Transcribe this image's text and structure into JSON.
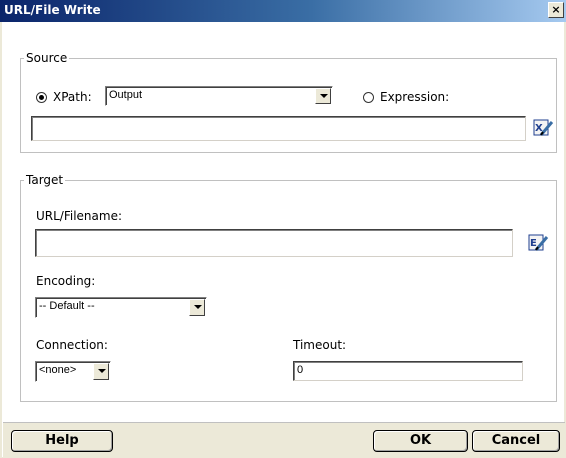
{
  "window": {
    "title": "URL/File Write",
    "close_label": "×"
  },
  "source": {
    "legend": "Source",
    "xpath_label": "XPath:",
    "xpath_selected": true,
    "xpath_value": "Output",
    "expression_label": "Expression:",
    "expression_selected": false,
    "expression_value": ""
  },
  "target": {
    "legend": "Target",
    "url_label": "URL/Filename:",
    "url_value": "",
    "encoding_label": "Encoding:",
    "encoding_value": "-- Default --",
    "connection_label": "Connection:",
    "connection_value": "<none>",
    "timeout_label": "Timeout:",
    "timeout_value": "0"
  },
  "buttons": {
    "help": "Help",
    "ok": "OK",
    "cancel": "Cancel"
  },
  "icons": {
    "expression_editor": "edit-expression-icon",
    "url_editor": "edit-url-icon"
  },
  "colors": {
    "titlebar_start": "#0a246a",
    "titlebar_end": "#a6caf0",
    "dialog_bg": "#ece9d8"
  }
}
